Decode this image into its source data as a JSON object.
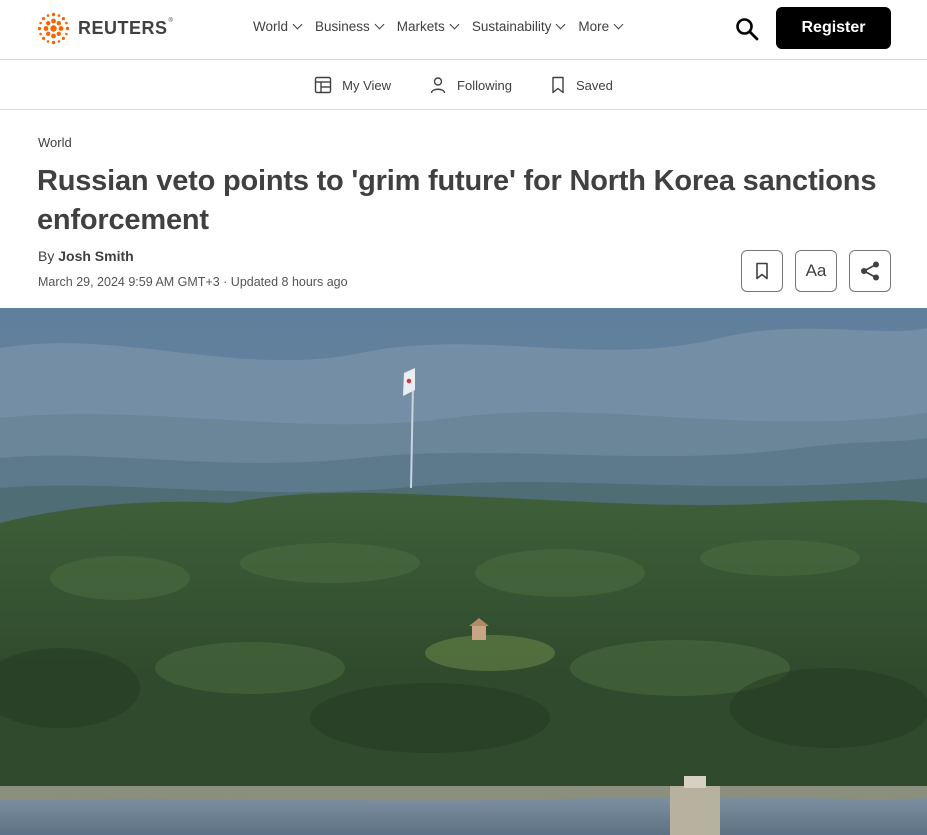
{
  "header": {
    "logo_text": "REUTERS",
    "logo_mark": "®",
    "nav": [
      {
        "label": "World"
      },
      {
        "label": "Business"
      },
      {
        "label": "Markets"
      },
      {
        "label": "Sustainability"
      },
      {
        "label": "More"
      }
    ],
    "register_label": "Register",
    "search_icon": "search-icon"
  },
  "subnav": {
    "items": [
      {
        "label": "My View",
        "icon": "my-view-icon"
      },
      {
        "label": "Following",
        "icon": "person-icon"
      },
      {
        "label": "Saved",
        "icon": "bookmark-icon"
      }
    ]
  },
  "article": {
    "section": "World",
    "headline": "Russian veto points to 'grim future' for North Korea sanctions enforcement",
    "byline_prefix": "By",
    "author": "Josh Smith",
    "date": "March 29, 2024 9:59 AM GMT+3 · Updated 8 hours ago",
    "tools": {
      "save_icon": "bookmark-icon",
      "text_size_label": "Aa",
      "share_icon": "share-icon"
    }
  },
  "colors": {
    "logo_orange": "#fa6400",
    "text": "#404040",
    "register_bg": "#000000"
  }
}
